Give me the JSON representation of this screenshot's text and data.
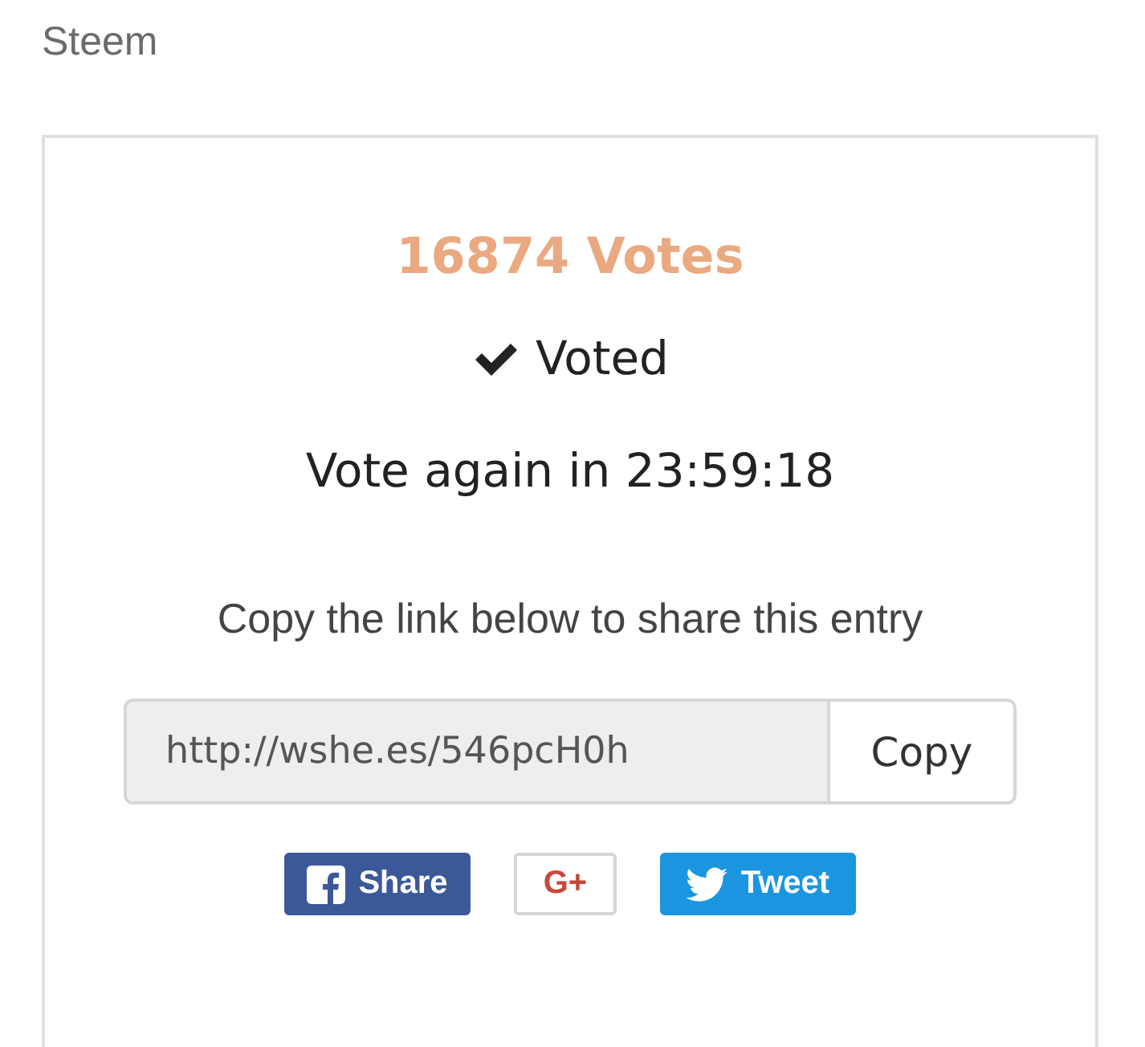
{
  "heading": "Steem",
  "card": {
    "votes": "16874 Votes",
    "status": {
      "label": "Voted",
      "voted": true
    },
    "countdown": "Vote again in 23:59:18",
    "share_prompt": "Copy the link below to share this entry",
    "link": {
      "value": "http://wshe.es/546pcH0h",
      "button": "Copy"
    },
    "social": [
      {
        "kind": "facebook",
        "label": "Share"
      },
      {
        "kind": "google",
        "label": "G+"
      },
      {
        "kind": "twitter",
        "label": "Tweet"
      }
    ]
  }
}
